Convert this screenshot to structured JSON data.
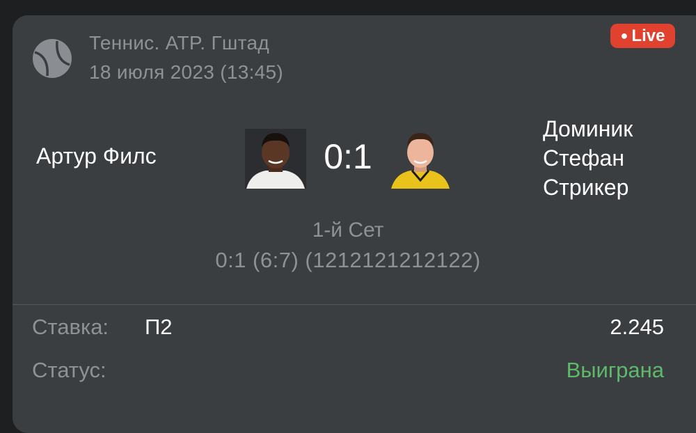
{
  "header": {
    "league": "Теннис. ATP. Гштад",
    "datetime": "18 июля 2023 (13:45)",
    "live_badge": "Live",
    "sport_icon": "tennis-ball-icon"
  },
  "match": {
    "player1": "Артур Филс",
    "player2_lines": [
      "Доминик",
      "Стефан",
      "Стрикер"
    ],
    "score": "0:1"
  },
  "set": {
    "title": "1-й Сет",
    "detail": "0:1 (6:7) (1212121212122)"
  },
  "bet": {
    "label": "Ставка:",
    "value": "П2",
    "odds": "2.245",
    "status_label": "Статус:",
    "status_value": "Выиграна"
  },
  "colors": {
    "background": "#1e1f21",
    "card": "#3b3e41",
    "muted_text": "#8e9296",
    "live": "#e0422f",
    "won": "#5fb96b"
  }
}
